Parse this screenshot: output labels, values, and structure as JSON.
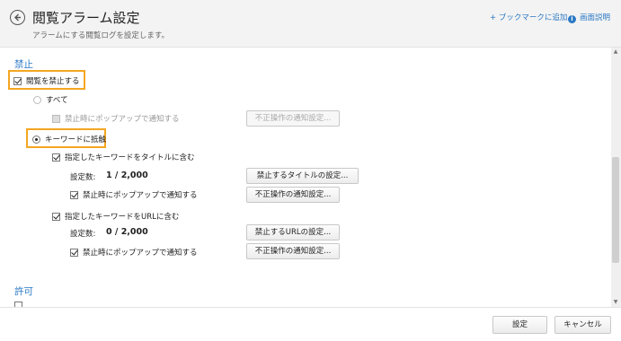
{
  "header": {
    "title": "閲覧アラーム設定",
    "subtitle": "アラームにする閲覧ログを設定します。",
    "bookmark_link": "+ ブックマークに追加",
    "help_link": "画面説明",
    "help_icon_glyph": "i"
  },
  "block_section": {
    "title": "禁止",
    "block_browsing_label": "閲覧を禁止する",
    "all_label": "すべて",
    "all_popup_label": "禁止時にポップアップで通知する",
    "all_notify_button": "不正操作の通知設定...",
    "keyword_label": "キーワードに抵触",
    "title_keyword_label": "指定したキーワードをタイトルに含む",
    "title_count_label": "設定数:",
    "title_count_value": "1 / 2,000",
    "title_settings_button": "禁止するタイトルの設定...",
    "title_popup_label": "禁止時にポップアップで通知する",
    "title_notify_button": "不正操作の通知設定...",
    "url_keyword_label": "指定したキーワードをURLに含む",
    "url_count_label": "設定数:",
    "url_count_value": "0 / 2,000",
    "url_settings_button": "禁止するURLの設定...",
    "url_popup_label": "禁止時にポップアップで通知する",
    "url_notify_button": "不正操作の通知設定..."
  },
  "allow_section": {
    "title": "許可"
  },
  "footer": {
    "ok_button": "設定",
    "cancel_button": "キャンセル"
  },
  "colors": {
    "accent": "#2a78c4",
    "highlight": "#f4a622"
  }
}
